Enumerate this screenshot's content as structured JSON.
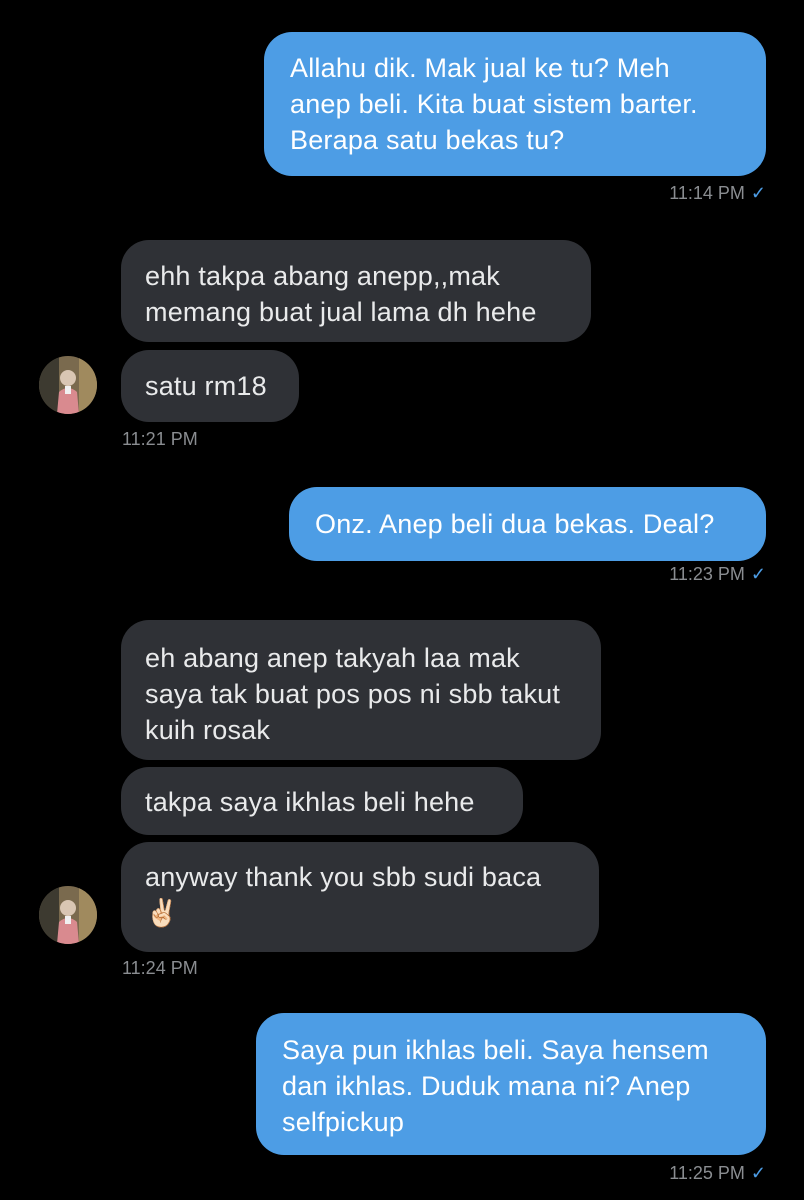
{
  "messages": [
    {
      "direction": "outgoing",
      "text": "Allahu dik. Mak jual ke tu? Meh\nanep beli. Kita buat sistem barter.\nBerapa satu bekas tu?"
    },
    {
      "direction": "incoming",
      "text": "ehh takpa abang anepp,,mak\nmemang buat jual lama dh hehe"
    },
    {
      "direction": "incoming",
      "text": "satu rm18"
    },
    {
      "direction": "outgoing",
      "text": "Onz. Anep beli dua bekas. Deal?"
    },
    {
      "direction": "incoming",
      "text": "eh abang anep takyah laa mak\nsaya tak buat pos pos ni sbb takut\nkuih rosak"
    },
    {
      "direction": "incoming",
      "text": "takpa saya ikhlas beli hehe"
    },
    {
      "direction": "incoming",
      "text": "anyway thank you sbb sudi baca\n✌🏻"
    },
    {
      "direction": "outgoing",
      "text": "Saya pun ikhlas beli. Saya hensem\ndan ikhlas. Duduk mana ni? Anep\nselfpickup"
    }
  ],
  "timestamps": [
    "11:14 PM",
    "11:21 PM",
    "11:23 PM",
    "11:24 PM",
    "11:25 PM"
  ],
  "read_check": "✓",
  "colors": {
    "outgoing_bubble": "#4d9de5",
    "incoming_bubble": "#2f3136",
    "background": "#000000",
    "timestamp": "#8a8d91"
  }
}
